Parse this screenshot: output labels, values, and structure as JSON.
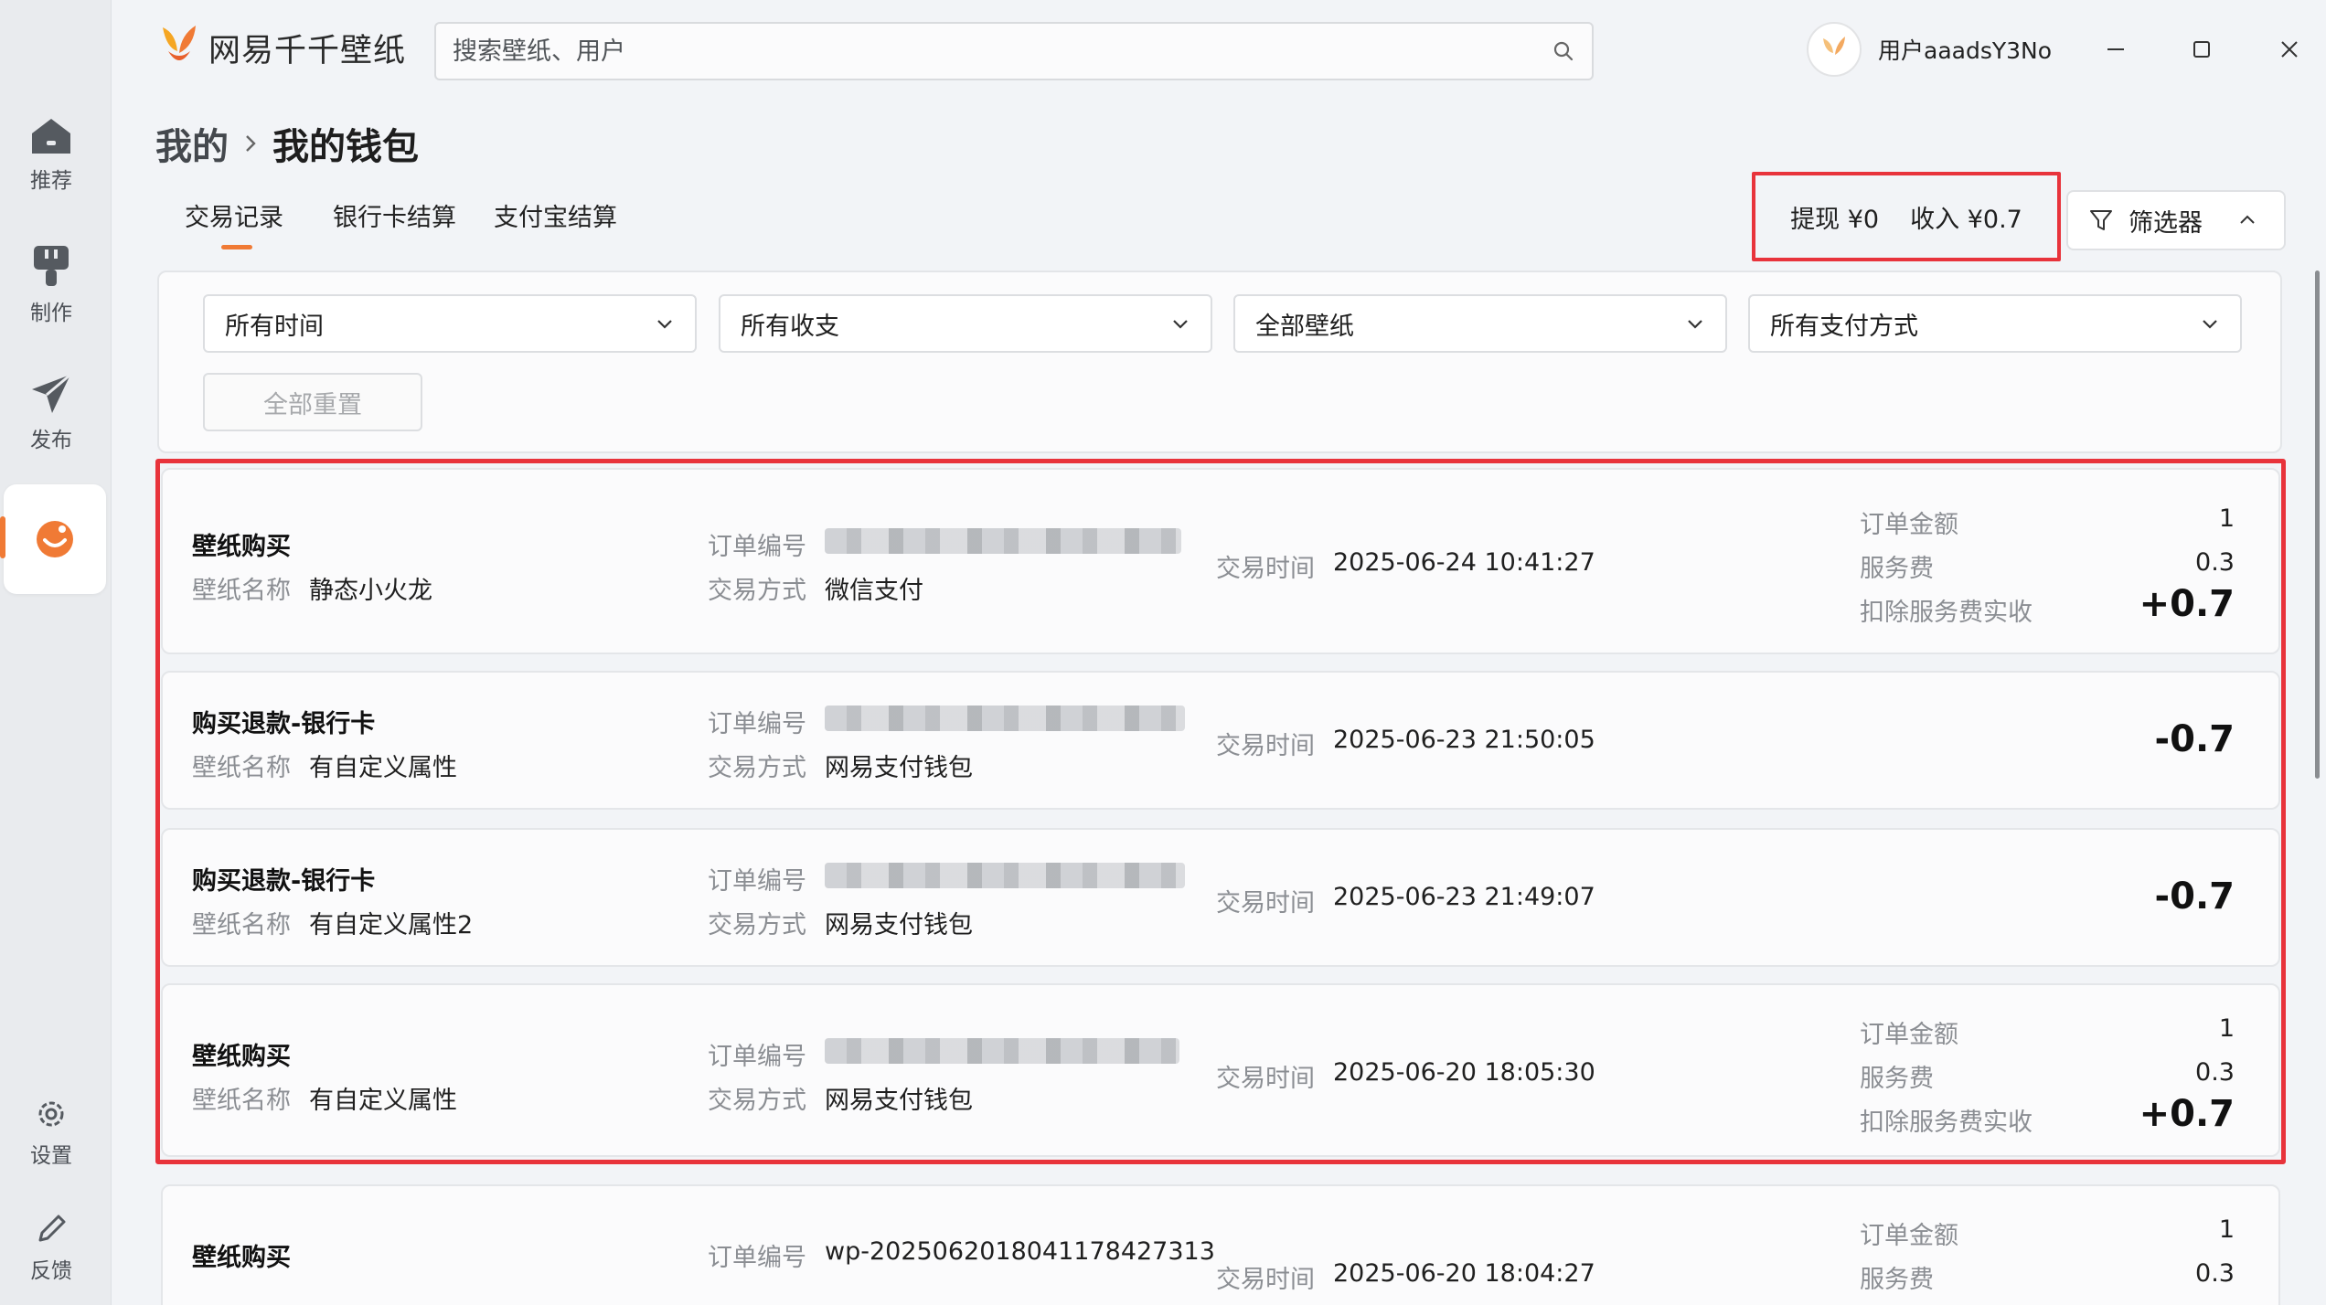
{
  "app": {
    "name": "网易千千壁纸"
  },
  "search": {
    "placeholder": "搜索壁纸、用户"
  },
  "user": {
    "name": "用户aaadsY3No"
  },
  "sidebar": {
    "items": [
      {
        "label": "推荐",
        "icon": "home-icon"
      },
      {
        "label": "制作",
        "icon": "brush-icon"
      },
      {
        "label": "发布",
        "icon": "send-icon"
      },
      {
        "label": "",
        "icon": "wallet-icon",
        "active": true
      },
      {
        "label": "设置",
        "icon": "gear-icon"
      },
      {
        "label": "反馈",
        "icon": "pen-icon"
      }
    ]
  },
  "breadcrumb": {
    "parent": "我的",
    "current": "我的钱包"
  },
  "tabs": [
    {
      "label": "交易记录",
      "active": true
    },
    {
      "label": "银行卡结算"
    },
    {
      "label": "支付宝结算"
    }
  ],
  "summary": {
    "withdraw": "提现 ¥0",
    "income": "收入 ¥0.7"
  },
  "filter_button": {
    "label": "筛选器"
  },
  "filters": {
    "time": "所有时间",
    "flow": "所有收支",
    "wallpaper": "全部壁纸",
    "payment": "所有支付方式",
    "reset": "全部重置"
  },
  "labels": {
    "wallpaper_name": "壁纸名称",
    "order_no": "订单编号",
    "pay_method": "交易方式",
    "trade_time": "交易时间",
    "order_amount": "订单金额",
    "service_fee": "服务费",
    "net_amount": "扣除服务费实收"
  },
  "records": [
    {
      "type": "壁纸购买",
      "wallpaper": "静态小火龙",
      "order_no": "",
      "pay_method": "微信支付",
      "time": "2025-06-24 10:41:27",
      "order_amount": "1",
      "service_fee": "0.3",
      "amount": "+0.7"
    },
    {
      "type": "购买退款-银行卡",
      "wallpaper": "有自定义属性",
      "order_no": "",
      "pay_method": "网易支付钱包",
      "time": "2025-06-23 21:50:05",
      "amount": "-0.7"
    },
    {
      "type": "购买退款-银行卡",
      "wallpaper": "有自定义属性2",
      "order_no": "",
      "pay_method": "网易支付钱包",
      "time": "2025-06-23 21:49:07",
      "amount": "-0.7"
    },
    {
      "type": "壁纸购买",
      "wallpaper": "有自定义属性",
      "order_no": "",
      "pay_method": "网易支付钱包",
      "time": "2025-06-20 18:05:30",
      "order_amount": "1",
      "service_fee": "0.3",
      "amount": "+0.7"
    },
    {
      "type": "壁纸购买",
      "order_no": "wp-2025062018041178427313",
      "time": "2025-06-20 18:04:27",
      "order_amount": "1",
      "service_fee": "0.3"
    }
  ],
  "colors": {
    "accent": "#f07a35",
    "highlight": "#e8333b"
  }
}
